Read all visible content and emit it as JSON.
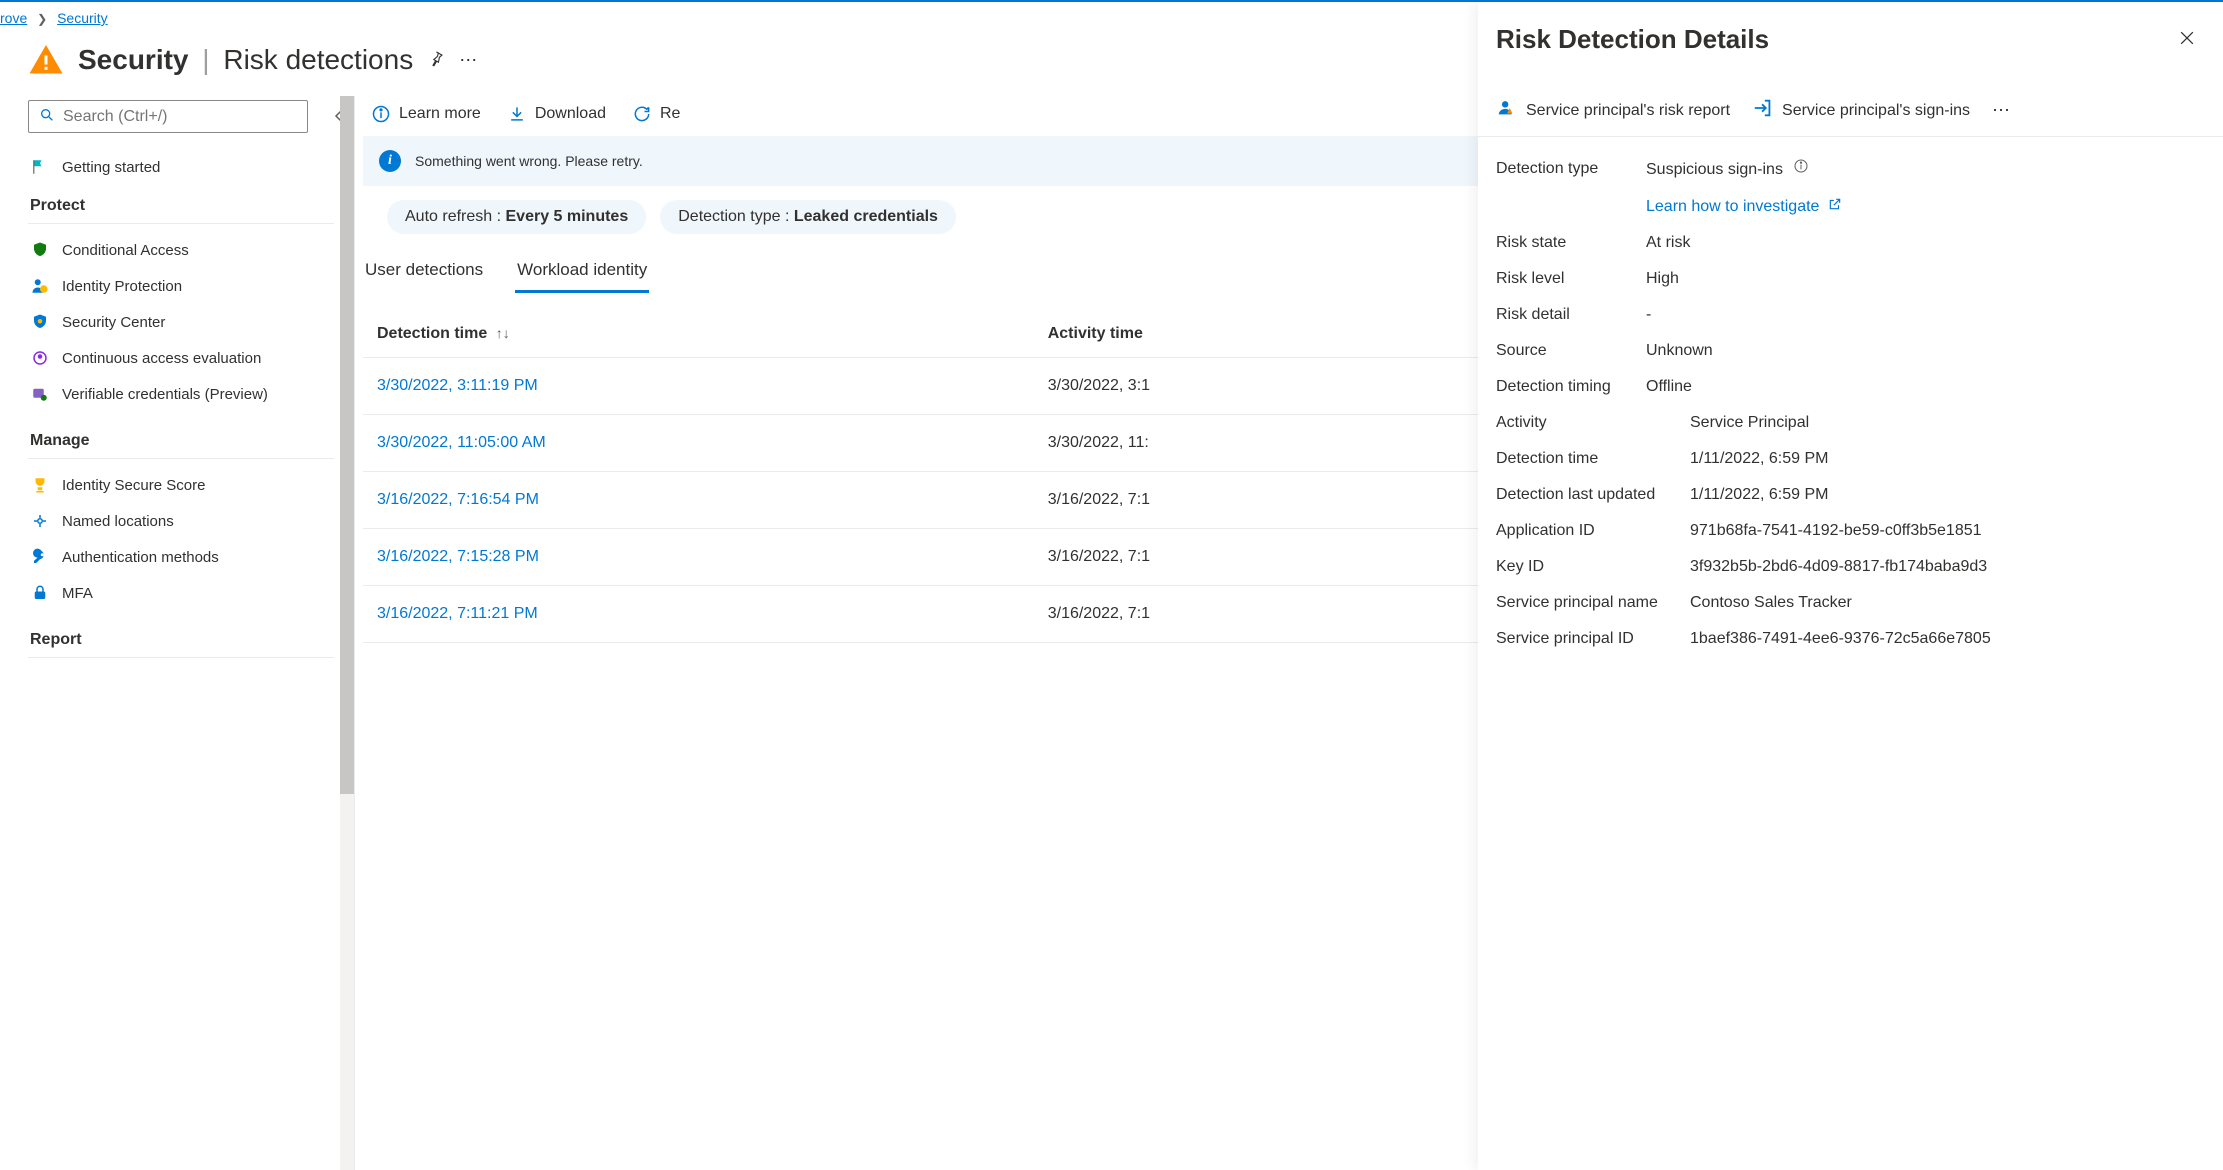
{
  "breadcrumb": {
    "prev_partial": "rove",
    "current": "Security"
  },
  "title": {
    "main": "Security",
    "divider": "|",
    "sub": "Risk detections"
  },
  "search": {
    "placeholder": "Search (Ctrl+/)"
  },
  "sidebar": {
    "getting_started": "Getting started",
    "section_protect": "Protect",
    "section_manage": "Manage",
    "section_report": "Report",
    "protect_items": {
      "conditional_access": "Conditional Access",
      "identity_protection": "Identity Protection",
      "security_center": "Security Center",
      "continuous_access": "Continuous access evaluation",
      "verifiable_credentials": "Verifiable credentials (Preview)"
    },
    "manage_items": {
      "identity_secure_score": "Identity Secure Score",
      "named_locations": "Named locations",
      "auth_methods": "Authentication methods",
      "mfa": "MFA"
    }
  },
  "commands": {
    "learn_more": "Learn more",
    "download": "Download",
    "refresh": "Re"
  },
  "banner": {
    "message": "Something went wrong. Please retry."
  },
  "filters": {
    "auto_refresh": {
      "label": "Auto refresh : ",
      "value": "Every 5 minutes"
    },
    "detection_type": {
      "label": "Detection type : ",
      "value": "Leaked credentials"
    }
  },
  "tabs": {
    "user": "User detections",
    "workload": "Workload identity"
  },
  "table": {
    "headers": {
      "detection_time": "Detection time",
      "activity_time": "Activity time"
    },
    "rows": [
      {
        "detection": "3/30/2022, 3:11:19 PM",
        "activity": "3/30/2022, 3:1"
      },
      {
        "detection": "3/30/2022, 11:05:00 AM",
        "activity": "3/30/2022, 11:"
      },
      {
        "detection": "3/16/2022, 7:16:54 PM",
        "activity": "3/16/2022, 7:1"
      },
      {
        "detection": "3/16/2022, 7:15:28 PM",
        "activity": "3/16/2022, 7:1"
      },
      {
        "detection": "3/16/2022, 7:11:21 PM",
        "activity": "3/16/2022, 7:1"
      }
    ]
  },
  "details": {
    "title": "Risk Detection Details",
    "commands": {
      "risk_report": "Service principal's risk report",
      "signins": "Service principal's sign-ins"
    },
    "fields": {
      "detection_type": {
        "k": "Detection type",
        "v": "Suspicious sign-ins"
      },
      "investigate_link": "Learn how to investigate",
      "risk_state": {
        "k": "Risk state",
        "v": "At risk"
      },
      "risk_level": {
        "k": "Risk level",
        "v": "High"
      },
      "risk_detail": {
        "k": "Risk detail",
        "v": "-"
      },
      "source": {
        "k": "Source",
        "v": "Unknown"
      },
      "detection_timing": {
        "k": "Detection timing",
        "v": "Offline"
      },
      "activity": {
        "k": "Activity",
        "v": "Service Principal"
      },
      "detection_time": {
        "k": "Detection time",
        "v": "1/11/2022, 6:59 PM"
      },
      "detection_last_updated": {
        "k": "Detection last updated",
        "v": "1/11/2022, 6:59 PM"
      },
      "application_id": {
        "k": "Application ID",
        "v": "971b68fa-7541-4192-be59-c0ff3b5e1851"
      },
      "key_id": {
        "k": "Key ID",
        "v": "3f932b5b-2bd6-4d09-8817-fb174baba9d3"
      },
      "sp_name": {
        "k": "Service principal name",
        "v": "Contoso Sales Tracker"
      },
      "sp_id": {
        "k": "Service principal ID",
        "v": "1baef386-7491-4ee6-9376-72c5a66e7805"
      }
    }
  }
}
